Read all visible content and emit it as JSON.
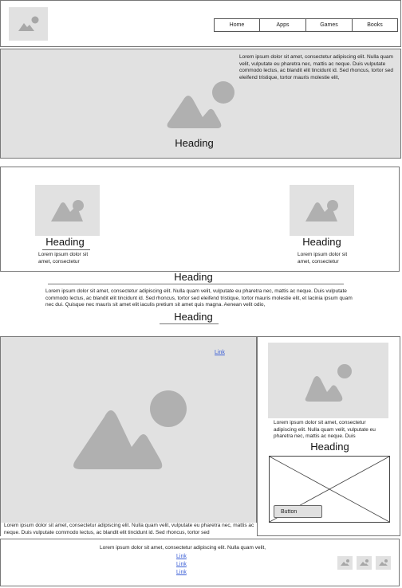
{
  "nav": {
    "items": [
      "Home",
      "Apps",
      "Games",
      "Books"
    ]
  },
  "hero": {
    "text": "Lorem ipsum dolor sit amet, consectetur adipiscing elit. Nulla quam velit, vulputate eu pharetra nec, mattis ac neque. Duis vulputate commodo lectus, ac blandit elit tincidunt id. Sed rhoncus, tortor sed eleifend tristique, tortor mauris molestie elit,",
    "heading": "Heading"
  },
  "cards": [
    {
      "heading": "Heading",
      "text": "Lorem ipsum dolor sit amet, consectetur"
    },
    {
      "heading": "Heading",
      "text": "Lorem ipsum dolor sit amet, consectetur"
    }
  ],
  "middle": {
    "heading": "Heading",
    "text": "Lorem ipsum dolor sit amet, consectetur adipiscing elit. Nulla quam velit, vulputate eu pharetra nec, mattis ac neque. Duis vulputate commodo lectus, ac blandit elit tincidunt id. Sed rhoncus, tortor sed eleifend tristique, tortor mauris molestie elit, et lacinia ipsum quam nec dui. Quisque nec mauris sit amet elit iaculis pretium sit amet quis magna. Aenean velit odio,",
    "heading2": "Heading"
  },
  "feature": {
    "link": "Link",
    "caption": "Lorem ipsum dolor sit amet, consectetur adipiscing elit. Nulla quam velit, vulputate eu pharetra nec, mattis ac neque. Duis vulputate commodo lectus, ac blandit elit tincidunt id. Sed rhoncus, tortor sed"
  },
  "sidebar": {
    "text": "Lorem ipsum dolor sit amet, consectetur adipiscing elit. Nulla quam velit, vulputate eu pharetra nec, mattis ac neque. Duis",
    "heading": "Heading",
    "button": "Button"
  },
  "footer": {
    "text": "Lorem ipsum dolor sit amet, consectetur adipiscing elit. Nulla quam velit,",
    "links": [
      "Link",
      "Link",
      "Link"
    ]
  }
}
